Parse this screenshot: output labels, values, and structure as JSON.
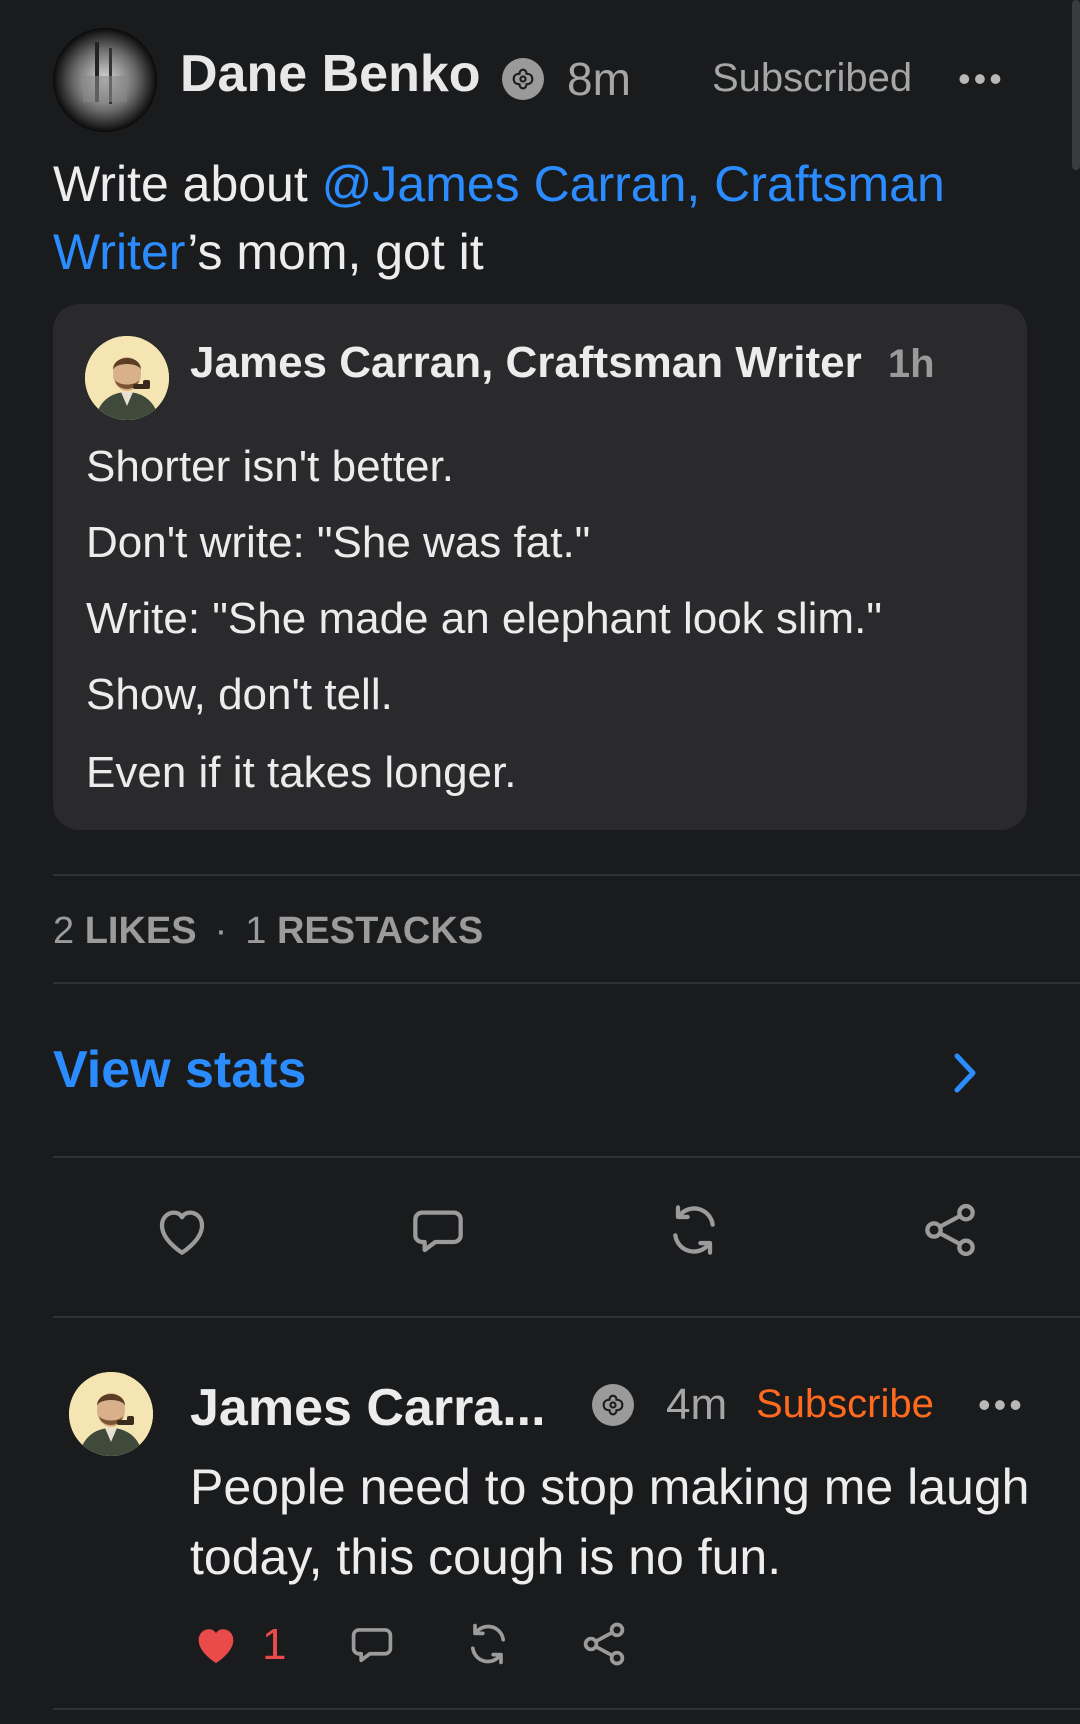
{
  "post": {
    "author": "Dane Benko",
    "time": "8m",
    "subscribed_label": "Subscribed",
    "more_label": "•••",
    "text_before": "Write about ",
    "mention": "@James Carran, Craftsman Writer",
    "text_after": "’s mom, got it"
  },
  "quote": {
    "author": "James Carran, Craftsman Writer",
    "time": "1h",
    "lines": [
      "Shorter isn't better.",
      "Don't write: \"She was fat.\"",
      "Write: \"She made an elephant look slim.\"",
      "Show, don't tell.",
      "Even if it takes longer."
    ]
  },
  "stats": {
    "likes_count": "2",
    "likes_label": "LIKES",
    "separator": "·",
    "restacks_count": "1",
    "restacks_label": "RESTACKS",
    "view_stats_label": "View stats"
  },
  "actions": [
    "heart-icon",
    "comment-icon",
    "restack-icon",
    "share-icon"
  ],
  "reply": {
    "author": "James Carra...",
    "time": "4m",
    "subscribe_label": "Subscribe",
    "more_label": "•••",
    "text": "People need to stop making me laugh today, this cough is no fun.",
    "like_count": "1"
  },
  "colors": {
    "background": "#1a1b1d",
    "accent": "#2a8cff",
    "subscribe": "#ff6a1f",
    "liked": "#e94b4b"
  }
}
